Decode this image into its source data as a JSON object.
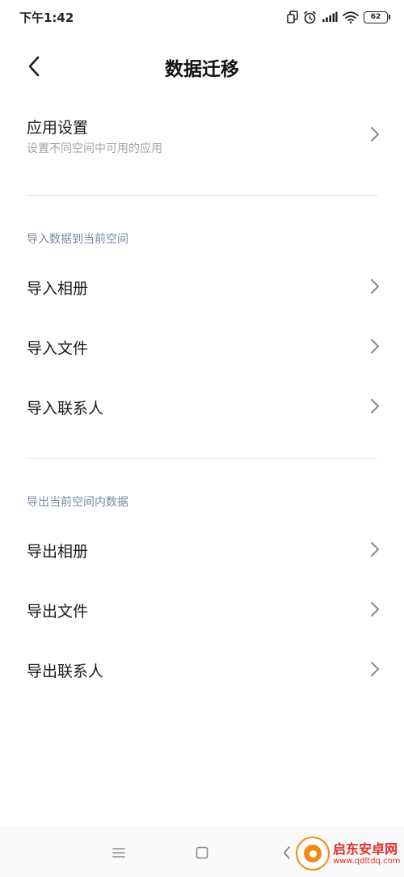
{
  "status_bar": {
    "time": "下午1:42",
    "battery_level": "62",
    "icons": [
      "dual-sim-icon",
      "alarm-icon",
      "signal-icon",
      "wifi-icon",
      "battery-icon"
    ]
  },
  "header": {
    "title": "数据迁移",
    "back_icon": "back-arrow-icon"
  },
  "app_settings": {
    "label": "应用设置",
    "subtitle": "设置不同空间中可用的应用"
  },
  "import_section": {
    "header": "导入数据到当前空间",
    "items": [
      {
        "label": "导入相册"
      },
      {
        "label": "导入文件"
      },
      {
        "label": "导入联系人"
      }
    ]
  },
  "export_section": {
    "header": "导出当前空间内数据",
    "items": [
      {
        "label": "导出相册"
      },
      {
        "label": "导出文件"
      },
      {
        "label": "导出联系人"
      }
    ]
  },
  "nav_bar": {
    "buttons": [
      "menu-icon",
      "home-icon",
      "back-icon"
    ]
  },
  "watermark": {
    "name": "启东安卓网",
    "url": "www.qdltdq.com"
  },
  "colors": {
    "section_header": "#7a88a6",
    "subtitle": "#a3a3a3",
    "divider": "#e8e8e8",
    "watermark": "#e2302a"
  }
}
